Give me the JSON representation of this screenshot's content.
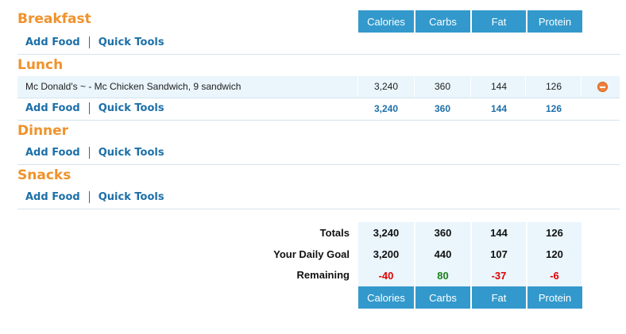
{
  "columns": [
    "Calories",
    "Carbs",
    "Fat",
    "Protein"
  ],
  "actions": {
    "add_food": "Add Food",
    "quick_tools": "Quick Tools"
  },
  "meals": [
    {
      "name": "Breakfast"
    },
    {
      "name": "Lunch",
      "entries": [
        {
          "food": "Mc Donald's ~ - Mc Chicken Sandwich, 9 sandwich",
          "calories": "3,240",
          "carbs": "360",
          "fat": "144",
          "protein": "126"
        }
      ],
      "totals": {
        "calories": "3,240",
        "carbs": "360",
        "fat": "144",
        "protein": "126"
      }
    },
    {
      "name": "Dinner"
    },
    {
      "name": "Snacks"
    }
  ],
  "summary": {
    "totals_label": "Totals",
    "totals": {
      "calories": "3,240",
      "carbs": "360",
      "fat": "144",
      "protein": "126"
    },
    "goal_label": "Your Daily Goal",
    "goal": {
      "calories": "3,200",
      "carbs": "440",
      "fat": "107",
      "protein": "120"
    },
    "remaining_label": "Remaining",
    "remaining": {
      "calories": "-40",
      "carbs": "80",
      "fat": "-37",
      "protein": "-6"
    }
  },
  "colors": {
    "accent": "#3399cc",
    "meal_title": "#f0922b",
    "link": "#1d6fa8",
    "negative": "#e00000",
    "positive": "#1a7f1a"
  },
  "icons": {
    "delete": "delete-entry-icon"
  }
}
